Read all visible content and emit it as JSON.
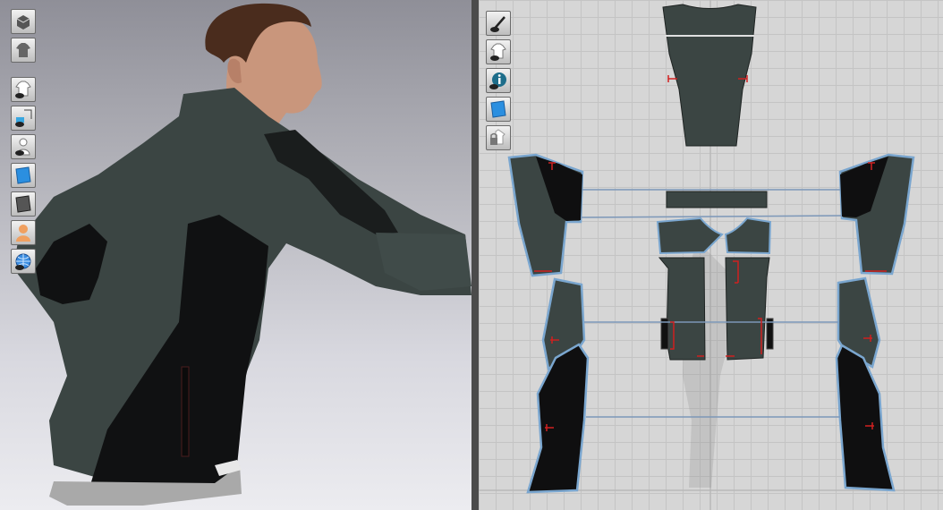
{
  "viewport3d": {
    "tools": [
      {
        "name": "cube-view-icon"
      },
      {
        "name": "garment-settings-icon"
      },
      {
        "name": "show-garment-icon"
      },
      {
        "name": "show-pins-icon"
      },
      {
        "name": "show-avatar-icon"
      },
      {
        "name": "texture-mode-icon"
      },
      {
        "name": "shaded-mode-icon"
      },
      {
        "name": "avatar-skin-icon"
      },
      {
        "name": "world-environment-icon"
      }
    ]
  },
  "viewport2d": {
    "tools": [
      {
        "name": "edit-pattern-tool-icon"
      },
      {
        "name": "show-garment-2d-icon"
      },
      {
        "name": "info-icon"
      },
      {
        "name": "texture-2d-icon"
      },
      {
        "name": "lock-pattern-icon"
      }
    ]
  },
  "colors": {
    "fabric_green": "#3b4543",
    "fabric_black": "#0f0f10",
    "outline_blue": "#7aa6cf",
    "sewing_line": "#7c97b8",
    "notch_red": "#d02020"
  }
}
